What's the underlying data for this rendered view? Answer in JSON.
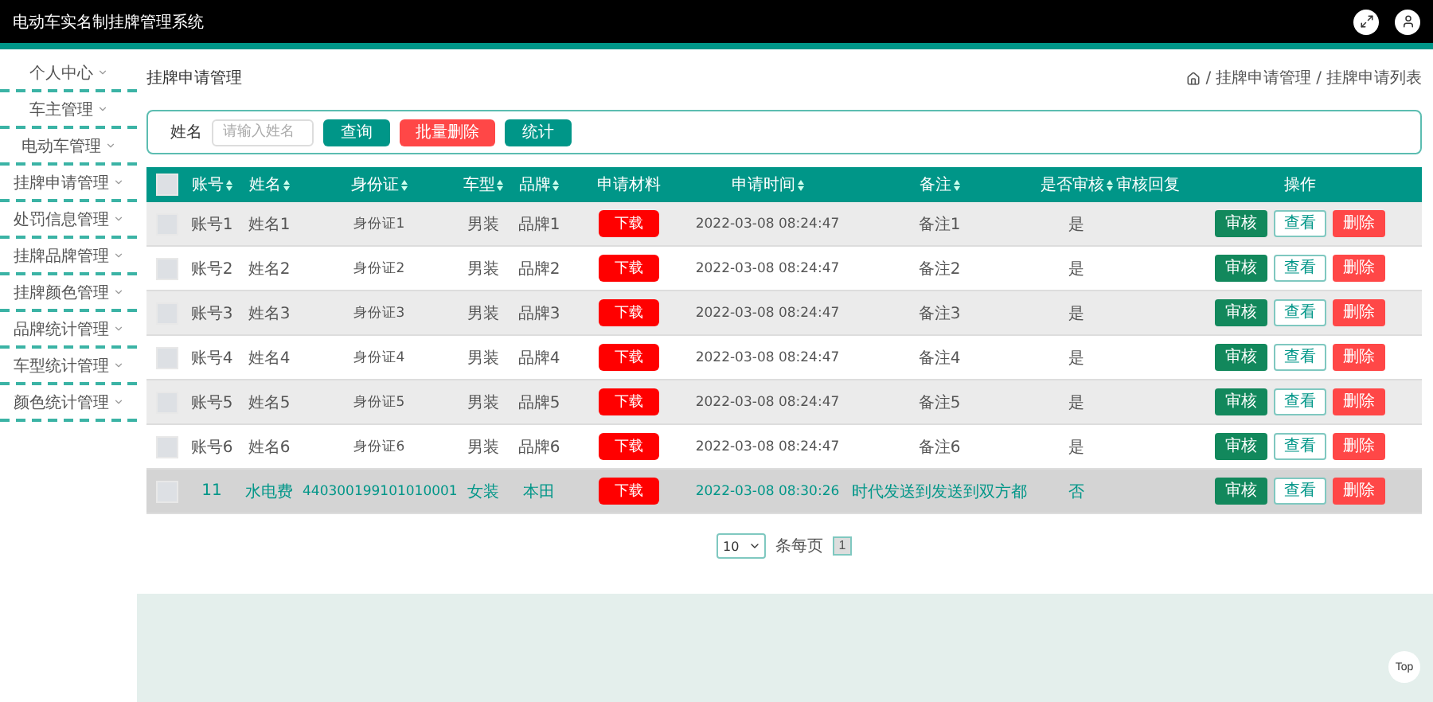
{
  "header": {
    "title": "电动车实名制挂牌管理系统"
  },
  "sidebar": {
    "items": [
      {
        "label": "个人中心",
        "expanded": false
      },
      {
        "label": "车主管理",
        "expanded": false
      },
      {
        "label": "电动车管理",
        "expanded": false
      },
      {
        "label": "挂牌申请管理",
        "expanded": false
      },
      {
        "label": "处罚信息管理",
        "expanded": false
      },
      {
        "label": "挂牌品牌管理",
        "expanded": false
      },
      {
        "label": "挂牌颜色管理",
        "expanded": false
      },
      {
        "label": "品牌统计管理",
        "expanded": false
      },
      {
        "label": "车型统计管理",
        "expanded": false
      },
      {
        "label": "颜色统计管理",
        "expanded": false
      }
    ]
  },
  "page_title": "挂牌申请管理",
  "breadcrumb": [
    {
      "separator": "/",
      "label": "挂牌申请管理"
    },
    {
      "separator": "/",
      "label": "挂牌申请列表"
    }
  ],
  "search": {
    "label": "姓名",
    "placeholder": "请输入姓名",
    "buttons": [
      {
        "label": "查询",
        "kind": "primary"
      },
      {
        "label": "批量删除",
        "kind": "danger"
      },
      {
        "label": "统计",
        "kind": "primary"
      }
    ]
  },
  "table": {
    "select_all_checked": false,
    "columns": [
      {
        "label": "账号",
        "sortable": true
      },
      {
        "label": "姓名",
        "sortable": true
      },
      {
        "label": "身份证",
        "sortable": true
      },
      {
        "label": "车型",
        "sortable": true
      },
      {
        "label": "品牌",
        "sortable": true
      },
      {
        "label": "申请材料",
        "sortable": false
      },
      {
        "label": "申请时间",
        "sortable": true
      },
      {
        "label": "备注",
        "sortable": true
      },
      {
        "label": "是否审核",
        "sortable": true
      },
      {
        "label": "审核回复",
        "sortable": false
      },
      {
        "label": "操作",
        "sortable": false
      }
    ],
    "rows": [
      {
        "selected": false,
        "checked": false,
        "cells": [
          "账号1",
          "姓名1",
          "身份证1",
          "男装",
          "品牌1",
          "下载",
          "2022-03-08 08:24:47",
          "备注1",
          "是",
          ""
        ],
        "actions": [
          {
            "label": "审核",
            "kind": "primary"
          },
          {
            "label": "查看",
            "kind": "outline"
          },
          {
            "label": "删除",
            "kind": "danger"
          }
        ]
      },
      {
        "selected": false,
        "checked": false,
        "cells": [
          "账号2",
          "姓名2",
          "身份证2",
          "男装",
          "品牌2",
          "下载",
          "2022-03-08 08:24:47",
          "备注2",
          "是",
          ""
        ],
        "actions": [
          {
            "label": "审核",
            "kind": "primary"
          },
          {
            "label": "查看",
            "kind": "outline"
          },
          {
            "label": "删除",
            "kind": "danger"
          }
        ]
      },
      {
        "selected": false,
        "checked": false,
        "cells": [
          "账号3",
          "姓名3",
          "身份证3",
          "男装",
          "品牌3",
          "下载",
          "2022-03-08 08:24:47",
          "备注3",
          "是",
          ""
        ],
        "actions": [
          {
            "label": "审核",
            "kind": "primary"
          },
          {
            "label": "查看",
            "kind": "outline"
          },
          {
            "label": "删除",
            "kind": "danger"
          }
        ]
      },
      {
        "selected": false,
        "checked": false,
        "cells": [
          "账号4",
          "姓名4",
          "身份证4",
          "男装",
          "品牌4",
          "下载",
          "2022-03-08 08:24:47",
          "备注4",
          "是",
          ""
        ],
        "actions": [
          {
            "label": "审核",
            "kind": "primary"
          },
          {
            "label": "查看",
            "kind": "outline"
          },
          {
            "label": "删除",
            "kind": "danger"
          }
        ]
      },
      {
        "selected": false,
        "checked": false,
        "cells": [
          "账号5",
          "姓名5",
          "身份证5",
          "男装",
          "品牌5",
          "下载",
          "2022-03-08 08:24:47",
          "备注5",
          "是",
          ""
        ],
        "actions": [
          {
            "label": "审核",
            "kind": "primary"
          },
          {
            "label": "查看",
            "kind": "outline"
          },
          {
            "label": "删除",
            "kind": "danger"
          }
        ]
      },
      {
        "selected": false,
        "checked": false,
        "cells": [
          "账号6",
          "姓名6",
          "身份证6",
          "男装",
          "品牌6",
          "下载",
          "2022-03-08 08:24:47",
          "备注6",
          "是",
          ""
        ],
        "actions": [
          {
            "label": "审核",
            "kind": "primary"
          },
          {
            "label": "查看",
            "kind": "outline"
          },
          {
            "label": "删除",
            "kind": "danger"
          }
        ]
      },
      {
        "selected": true,
        "checked": false,
        "cells": [
          "11",
          "水电费",
          "440300199101010001",
          "女装",
          "本田",
          "下载",
          "2022-03-08 08:30:26",
          "时代发送到发送到双方都",
          "否",
          ""
        ],
        "actions": [
          {
            "label": "审核",
            "kind": "primary"
          },
          {
            "label": "查看",
            "kind": "outline"
          },
          {
            "label": "删除",
            "kind": "danger"
          }
        ]
      }
    ]
  },
  "pagination": {
    "page_size": "10",
    "page_size_label": "条每页",
    "pages": [
      {
        "label": "1",
        "selected": true
      }
    ]
  },
  "back_to_top": "Top"
}
